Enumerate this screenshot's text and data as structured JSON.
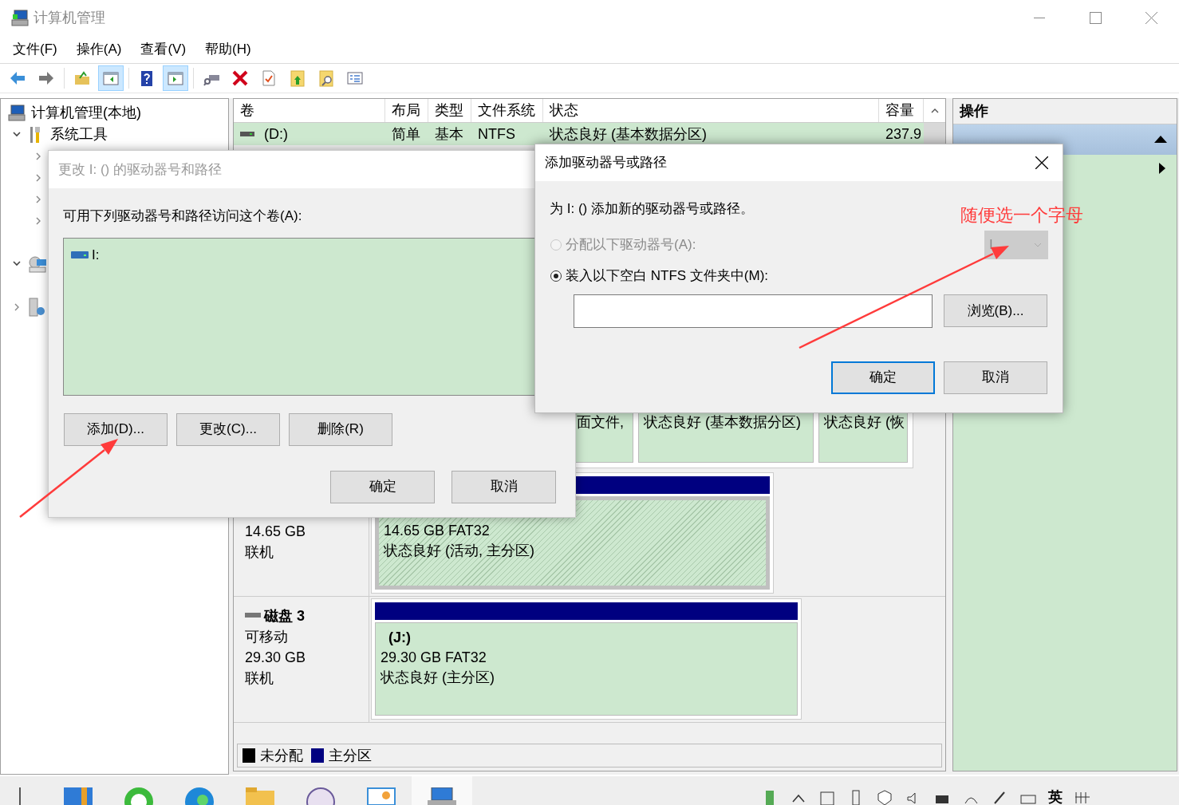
{
  "window": {
    "title": "计算机管理"
  },
  "menu": [
    "文件(F)",
    "操作(A)",
    "查看(V)",
    "帮助(H)"
  ],
  "toolbar": [
    {
      "kind": "back",
      "pressed": false
    },
    {
      "kind": "forward",
      "pressed": false
    },
    {
      "kind": "folder-up",
      "pressed": false
    },
    {
      "kind": "tree-toggle",
      "pressed": true
    },
    {
      "kind": "help",
      "pressed": false
    },
    {
      "kind": "pane-toggle",
      "pressed": true
    },
    {
      "kind": "connect",
      "pressed": false
    },
    {
      "kind": "delete",
      "pressed": false
    },
    {
      "kind": "properties",
      "pressed": false
    },
    {
      "kind": "export",
      "pressed": false
    },
    {
      "kind": "find",
      "pressed": false
    },
    {
      "kind": "list",
      "pressed": false
    }
  ],
  "tree": {
    "label": "计算机管理(本地)",
    "children": [
      {
        "kind": "tools",
        "label": "系统工具",
        "expanded": true,
        "children": [
          {
            "expanded": false
          },
          {
            "expanded": false
          },
          {
            "expanded": false
          },
          {
            "expanded": false
          }
        ]
      },
      {
        "kind": "storage",
        "expanded": true
      },
      {
        "kind": "services",
        "expanded": false
      }
    ]
  },
  "volume_table": {
    "columns": [
      "卷",
      "布局",
      "类型",
      "文件系统",
      "状态",
      "容量"
    ],
    "rows": [
      {
        "cells": [
          "(D:)",
          "简单",
          "基本",
          "NTFS",
          "状态良好 (基本数据分区)",
          "237.9"
        ]
      }
    ]
  },
  "disk_view": {
    "partial_partitions": [
      "面文件,",
      "状态良好 (基本数据分区)",
      "状态良好 (恢"
    ],
    "disks": [
      {
        "info": [
          "14.65 GB",
          "联机"
        ],
        "partition": {
          "lines": [
            "14.65 GB FAT32",
            "状态良好 (活动, 主分区)"
          ],
          "selected": true
        }
      },
      {
        "name": "磁盘 3",
        "info": [
          "可移动",
          "29.30 GB",
          "联机"
        ],
        "partition": {
          "label": "(J:)",
          "lines": [
            "29.30 GB FAT32",
            "状态良好 (主分区)"
          ],
          "selected": false
        }
      }
    ],
    "legend": [
      {
        "label": "未分配",
        "color": "#000000"
      },
      {
        "label": "主分区",
        "color": "#000080"
      }
    ]
  },
  "actions_pane": {
    "title": "操作",
    "expanded": true
  },
  "change_dialog": {
    "title": "更改 I: () 的驱动器号和路径",
    "label": "可用下列驱动器号和路径访问这个卷(A):",
    "items": [
      "I:"
    ],
    "buttons": [
      "添加(D)...",
      "更改(C)...",
      "删除(R)"
    ],
    "footer_buttons": [
      "确定",
      "取消"
    ]
  },
  "add_dialog": {
    "title": "添加驱动器号或路径",
    "prompt": "为 I: () 添加新的驱动器号或路径。",
    "options": [
      {
        "kind": "letter",
        "label": "分配以下驱动器号(A):",
        "selected": false,
        "disabled": true,
        "value": "I"
      },
      {
        "kind": "folder",
        "label": "装入以下空白 NTFS 文件夹中(M):",
        "selected": true,
        "disabled": false,
        "button": "浏览(B)..."
      }
    ],
    "buttons": [
      "确定",
      "取消"
    ]
  },
  "annotation": {
    "text": "随便选一个字母"
  },
  "taskbar": {
    "language": "英"
  }
}
